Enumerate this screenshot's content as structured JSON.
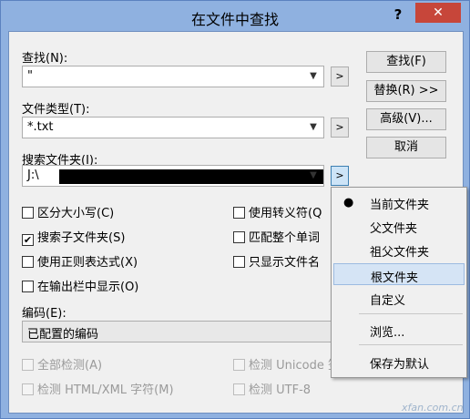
{
  "window": {
    "title": "在文件中查找",
    "help": "?",
    "close": "✕"
  },
  "find": {
    "label": "查找(N):",
    "value": "\""
  },
  "file_types": {
    "label": "文件类型(T):",
    "value": "*.txt"
  },
  "search_folder": {
    "label": "搜索文件夹(I):",
    "value": "J:\\"
  },
  "expand_btn": ">",
  "buttons": {
    "find": "查找(F)",
    "replace": "替换(R) >>",
    "advanced": "高级(V)...",
    "cancel": "取消"
  },
  "options": {
    "match_case": "区分大小写(C)",
    "subfolders": "搜索子文件夹(S)",
    "regex": "使用正则表达式(X)",
    "show_in_output": "在输出栏中显示(O)",
    "escape": "使用转义符(Q",
    "whole_word": "匹配整个单词",
    "filenames_only": "只显示文件名",
    "check_mark": "✔"
  },
  "encoding": {
    "label": "编码(E):",
    "value": "已配置的编码"
  },
  "detect": {
    "detect_all": "全部检测(A)",
    "detect_html": "检测 HTML/XML 字符(M)",
    "detect_unicode": "检测 Unicode 签",
    "detect_utf8": "检测 UTF-8"
  },
  "menu": {
    "bullet": "●",
    "current": "当前文件夹",
    "parent": "父文件夹",
    "grandparent": "祖父文件夹",
    "root": "根文件夹",
    "custom": "自定义",
    "browse": "浏览...",
    "save_default": "保存为默认"
  },
  "watermark": "xfan.com.cn"
}
